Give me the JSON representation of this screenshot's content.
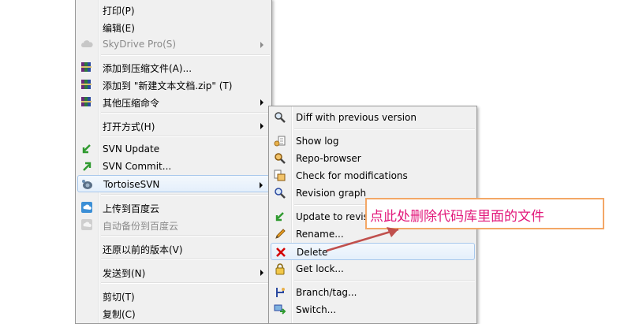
{
  "menu1": {
    "items": [
      {
        "label": "打印(P)"
      },
      {
        "label": "编辑(E)"
      },
      {
        "label": "SkyDrive Pro(S)"
      },
      {
        "label": "添加到压缩文件(A)..."
      },
      {
        "label": "添加到 \"新建文本文档.zip\" (T)"
      },
      {
        "label": "其他压缩命令"
      },
      {
        "label": "打开方式(H)"
      },
      {
        "label": "SVN Update"
      },
      {
        "label": "SVN Commit..."
      },
      {
        "label": "TortoiseSVN"
      },
      {
        "label": "上传到百度云"
      },
      {
        "label": "自动备份到百度云"
      },
      {
        "label": "还原以前的版本(V)"
      },
      {
        "label": "发送到(N)"
      },
      {
        "label": "剪切(T)"
      },
      {
        "label": "复制(C)"
      }
    ]
  },
  "menu2": {
    "items": [
      {
        "label": "Diff with previous version"
      },
      {
        "label": "Show log"
      },
      {
        "label": "Repo-browser"
      },
      {
        "label": "Check for modifications"
      },
      {
        "label": "Revision graph"
      },
      {
        "label": "Update to revision..."
      },
      {
        "label": "Rename..."
      },
      {
        "label": "Delete"
      },
      {
        "label": "Get lock..."
      },
      {
        "label": "Branch/tag..."
      },
      {
        "label": "Switch..."
      }
    ]
  },
  "annotation": {
    "text": "点此处删除代码库里面的文件",
    "border_color": "#f3a766",
    "text_color": "#e2197b",
    "arrow_color": "#c0504d"
  }
}
